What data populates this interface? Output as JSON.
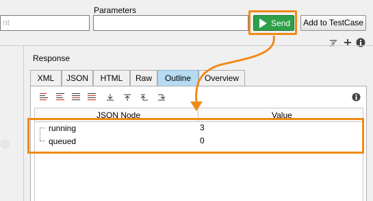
{
  "request": {
    "left_field_value": "nt",
    "parameters_label": "Parameters",
    "parameters_value": ""
  },
  "toolbar": {
    "send_label": "Send",
    "add_to_testcase_label": "Add to TestCase"
  },
  "response": {
    "section_label": "Response",
    "tabs": [
      "XML",
      "JSON",
      "HTML",
      "Raw",
      "Outline",
      "Overview"
    ],
    "active_tab": "Outline",
    "columns": [
      "JSON Node",
      "Value"
    ],
    "rows": [
      {
        "node": "running",
        "value": "3"
      },
      {
        "node": "queued",
        "value": "0"
      }
    ]
  },
  "icons": {
    "filter": "filter-icon",
    "add": "plus-icon",
    "info": "info-icon",
    "toolbar": [
      "sort-icon",
      "sort-icon",
      "sort-icon",
      "sort-icon",
      "expand-icon",
      "collapse-icon",
      "move-up-icon",
      "move-down-icon"
    ]
  },
  "colors": {
    "send_button": "#2fa04a",
    "highlight": "#f08a16",
    "active_tab": "#b7dcf2"
  }
}
